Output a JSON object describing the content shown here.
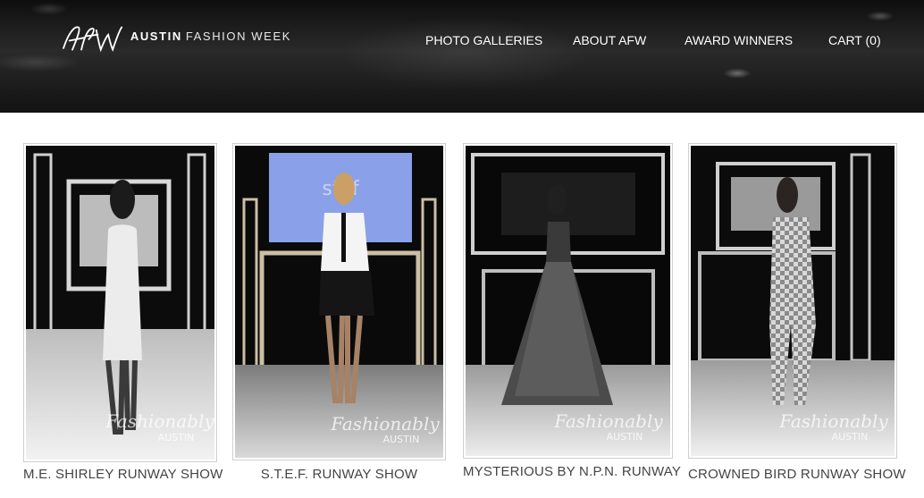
{
  "header": {
    "brand_strong": "AUSTIN",
    "brand_light": "FASHION WEEK",
    "nav": [
      {
        "label": "PHOTO GALLERIES"
      },
      {
        "label": "ABOUT AFW"
      },
      {
        "label": "AWARD WINNERS"
      },
      {
        "label": "CART (0)"
      }
    ]
  },
  "galleries": [
    {
      "caption": "M.E. SHIRLEY RUNWAY SHOW"
    },
    {
      "caption": "S.T.E.F. RUNWAY SHOW"
    },
    {
      "caption": "MYSTERIOUS BY N.P.N. RUNWAY"
    },
    {
      "caption": "CROWNED BIRD RUNWAY SHOW"
    }
  ]
}
